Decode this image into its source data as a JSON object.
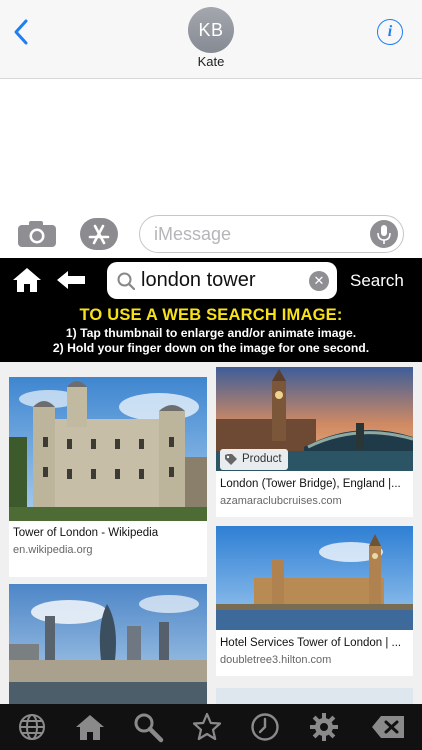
{
  "header": {
    "avatar_initials": "KB",
    "contact_name": "Kate",
    "back_icon": "chevron-left-icon",
    "info_icon": "info-icon",
    "info_glyph": "i",
    "accent": "#1f7ef2"
  },
  "compose": {
    "camera_icon": "camera-icon",
    "apps_icon": "app-store-icon",
    "placeholder": "iMessage",
    "mic_icon": "microphone-icon"
  },
  "search_app": {
    "query": "london tower",
    "clear_glyph": "✕",
    "search_label": "Search",
    "instructions": {
      "title": "TO USE A WEB SEARCH IMAGE:",
      "line1": "1) Tap thumbnail to enlarge and/or animate image.",
      "line2": "2) Hold your finger down on the image for one second."
    },
    "title_color": "#f7e21a",
    "results": [
      {
        "title": "Tower of London - Wikipedia",
        "domain": "en.wikipedia.org"
      },
      {
        "title": "London (Tower Bridge), England |...",
        "domain": "azamaraclubcruises.com",
        "tag": "Product"
      },
      {
        "title": "Hotel Services Tower of London | ...",
        "domain": "doubletree3.hilton.com"
      }
    ],
    "toolbar": [
      "globe-icon",
      "home-icon",
      "search-icon",
      "star-icon",
      "clock-icon",
      "gear-icon",
      "delete-icon"
    ]
  }
}
